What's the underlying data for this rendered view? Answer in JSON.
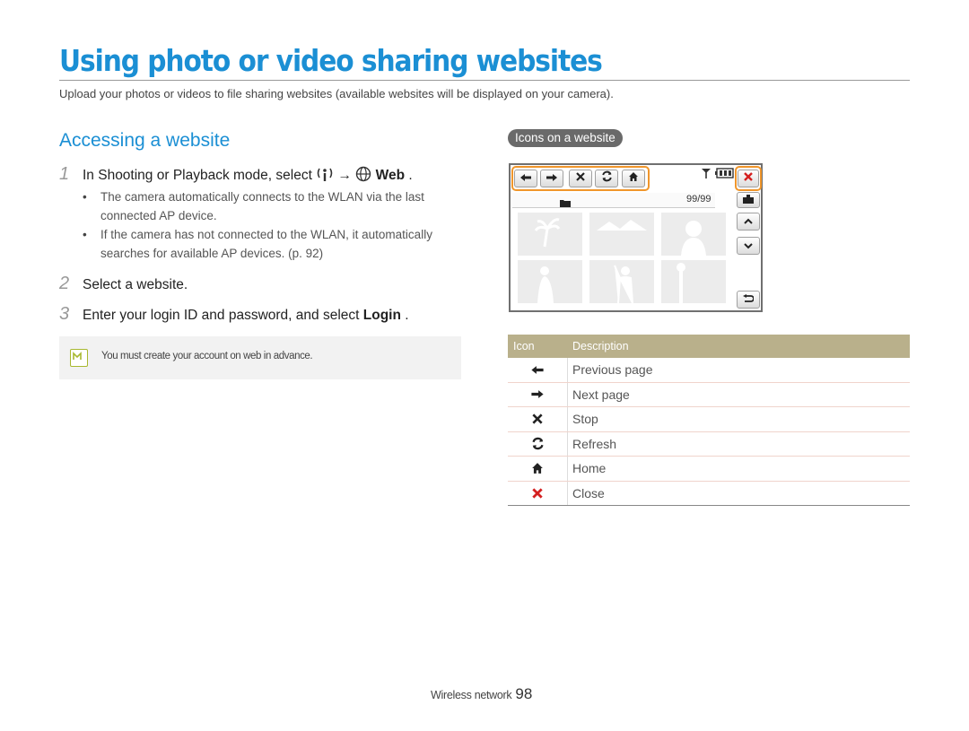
{
  "page": {
    "title": "Using photo or video sharing websites",
    "intro": "Upload your photos or videos to file sharing websites (available websites will be displayed on your camera)."
  },
  "section": {
    "title": "Accessing a website",
    "steps": [
      {
        "num": "1",
        "text_before": "In Shooting or Playback mode, select",
        "arrow": "→",
        "bold": "Web",
        "text_after": " ."
      },
      {
        "num": "2",
        "text": "Select a website."
      },
      {
        "num": "3",
        "text_before": "Enter your login ID and password, and select ",
        "bold": "Login",
        "text_after": " ."
      }
    ],
    "bullets": [
      "The camera automatically connects to the WLAN via the last connected AP device.",
      "If the camera has not connected to the WLAN, it automatically searches for available AP devices. (p. 92)"
    ],
    "note": "You must create your account on web in advance."
  },
  "figure": {
    "label": "Icons on a website",
    "counter": "99/99",
    "toolbar_icons": [
      "arrow-left-icon",
      "arrow-right-icon",
      "stop-icon",
      "refresh-icon",
      "home-icon"
    ],
    "close_icon": "close-icon",
    "accent_color": "#f0962b"
  },
  "icon_table": {
    "headers": [
      "Icon",
      "Description"
    ],
    "rows": [
      {
        "icon": "arrow-left-icon",
        "description": "Previous page"
      },
      {
        "icon": "arrow-right-icon",
        "description": "Next page"
      },
      {
        "icon": "stop-icon",
        "description": "Stop"
      },
      {
        "icon": "refresh-icon",
        "description": "Refresh"
      },
      {
        "icon": "home-icon",
        "description": "Home"
      },
      {
        "icon": "close-icon",
        "description": "Close"
      }
    ],
    "header_color": "#b9b08b"
  },
  "footer": {
    "label": "Wireless network",
    "page_number": "98"
  },
  "colors": {
    "title": "#1b8fd4",
    "close_red": "#d42020"
  }
}
